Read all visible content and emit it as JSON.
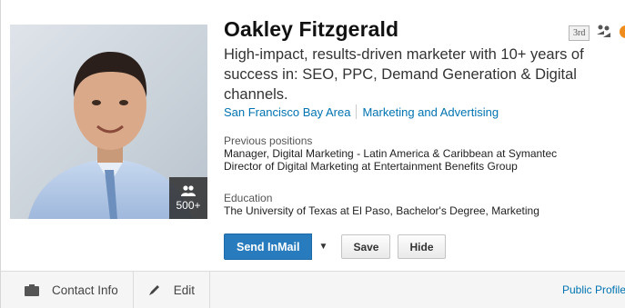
{
  "profile": {
    "name": "Oakley Fitzgerald",
    "degree": "3rd",
    "headline": "High-impact, results-driven marketer with 10+ years of success in: SEO, PPC, Demand Generation & Digital channels.",
    "location": "San Francisco Bay Area",
    "industry": "Marketing and Advertising",
    "connections": "500+"
  },
  "previous_positions": {
    "label": "Previous positions",
    "items": [
      "Manager, Digital Marketing - Latin America & Caribbean at Symantec",
      "Director of Digital Marketing at Entertainment Benefits Group"
    ]
  },
  "education": {
    "label": "Education",
    "items": [
      "The University of Texas at El Paso, Bachelor's Degree, Marketing"
    ]
  },
  "actions": {
    "send_inmail": "Send InMail",
    "save": "Save",
    "hide": "Hide"
  },
  "footer": {
    "contact_info": "Contact Info",
    "edit": "Edit",
    "public_profile": "Public Profile"
  },
  "icons": {
    "connections": "people-icon",
    "group": "group-icon",
    "contact": "contact-card-icon",
    "edit": "pencil-icon",
    "dropdown": "chevron-down-icon"
  },
  "colors": {
    "link": "#0073b1",
    "primary_button": "#287bbc",
    "badge_orange": "#f08c1b"
  }
}
